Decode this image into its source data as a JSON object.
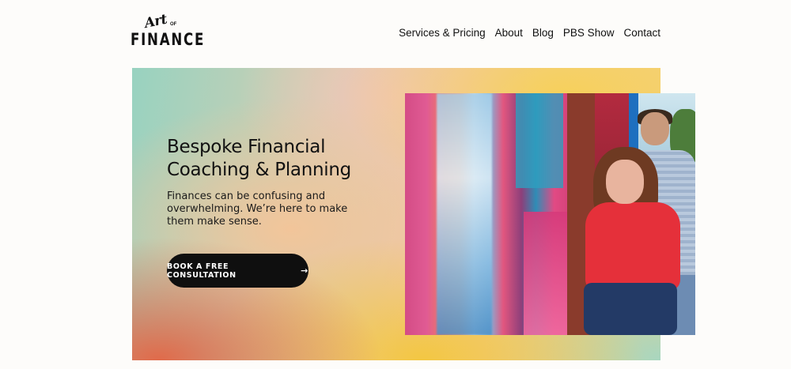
{
  "header": {
    "logo": {
      "script_text": "Art",
      "of_text": "OF",
      "main_text": "FINANCE"
    },
    "nav": [
      {
        "label": "Services & Pricing"
      },
      {
        "label": "About"
      },
      {
        "label": "Blog"
      },
      {
        "label": "PBS Show"
      },
      {
        "label": "Contact"
      }
    ]
  },
  "hero": {
    "title": "Bespoke Financial Coaching & Planning",
    "subtitle": "Finances can be confusing and overwhelming. We’re here to make them make sense.",
    "cta_label": "Book a free consultation",
    "cta_icon": "arrow-right-icon",
    "photo": "two people standing in front of a colorful mural"
  },
  "colors": {
    "background": "#fdfcfa",
    "text": "#111111",
    "cta_background": "#0f0f0f",
    "cta_text": "#ffffff",
    "gradient_teal": "#98d2c0",
    "gradient_peach": "#f0c8aa",
    "gradient_yellow": "#f5d07a",
    "gradient_coral": "#e06a4a"
  }
}
